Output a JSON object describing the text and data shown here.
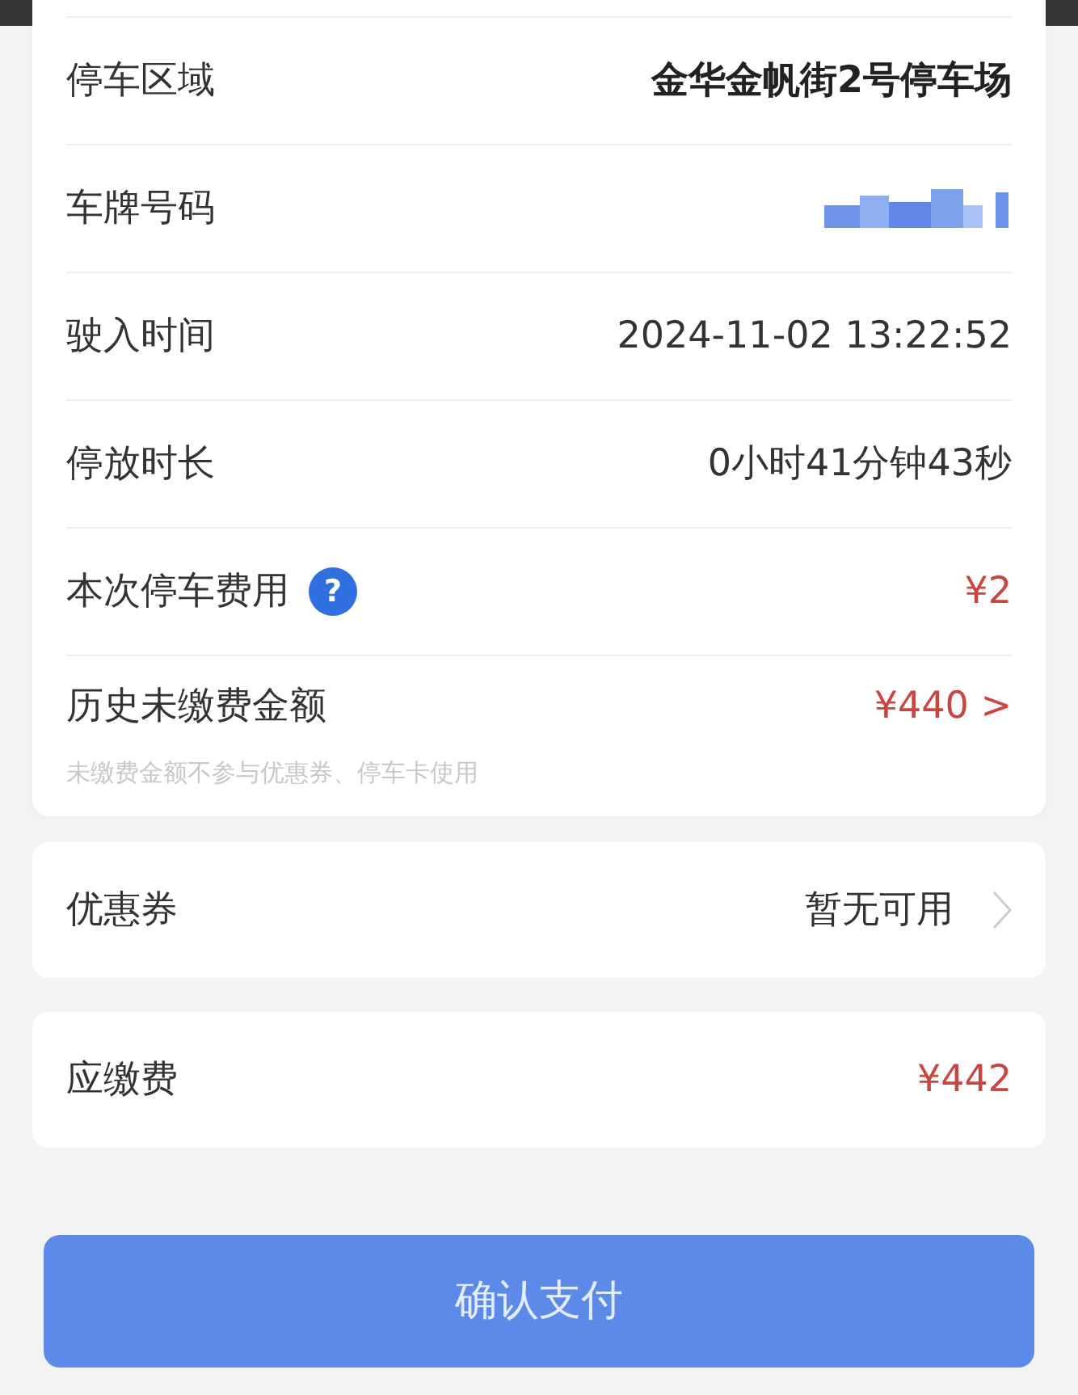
{
  "details": [
    {
      "label": "停车区域",
      "value": "金华金帆街2号停车场",
      "kind": "strong"
    },
    {
      "label": "车牌号码",
      "kind": "masked"
    },
    {
      "label": "驶入时间",
      "value": "2024-11-02 13:22:52",
      "kind": "plain"
    },
    {
      "label": "停放时长",
      "value": "0小时41分钟43秒",
      "kind": "plain"
    },
    {
      "label": "本次停车费用",
      "value": "¥2",
      "kind": "amount",
      "help": "?"
    },
    {
      "label": "历史未缴费金额",
      "value": "¥440 >",
      "kind": "amount",
      "note": "未缴费金额不参与优惠券、停车卡使用"
    }
  ],
  "coupon": {
    "label": "优惠券",
    "value": "暂无可用"
  },
  "total": {
    "label": "应缴费",
    "value": "¥442"
  },
  "confirm_button": "确认支付"
}
